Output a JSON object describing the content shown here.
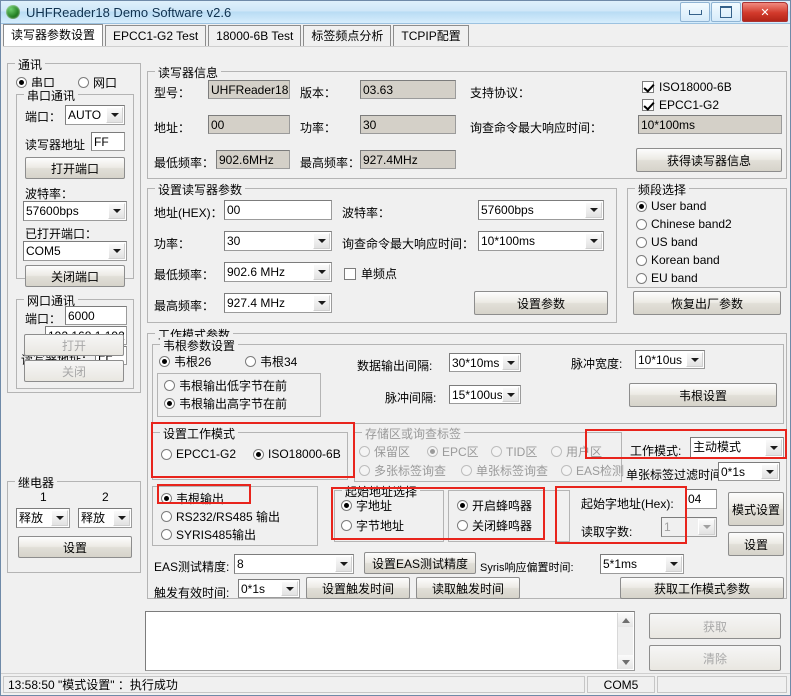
{
  "window": {
    "title": "UHFReader18 Demo Software v2.6",
    "icon": "globe-icon",
    "minimize_label": "–",
    "maximize_label": "□",
    "close_label": "✕"
  },
  "tabs": [
    {
      "label": "读写器参数设置",
      "active": true
    },
    {
      "label": "EPCC1-G2 Test",
      "active": false
    },
    {
      "label": "18000-6B Test",
      "active": false
    },
    {
      "label": "标签频点分析",
      "active": false
    },
    {
      "label": "TCPIP配置",
      "active": false
    }
  ],
  "comm": {
    "legend": "通讯",
    "mode_serial": "串口",
    "mode_net": "网口",
    "serial": {
      "legend": "串口通讯",
      "port_label": "端口：",
      "port_value": "AUTO",
      "addr_label": "读写器地址",
      "addr_value": "FF",
      "open_button": "打开端口",
      "baud_label": "波特率：",
      "baud_value": "57600bps",
      "opened_label": "已打开端口：",
      "opened_value": "COM5",
      "close_button": "关闭端口"
    },
    "net": {
      "legend": "网口通讯",
      "port_label": "端口：",
      "port_value": "6000",
      "ip_label": "IP:",
      "ip_value": "192.168.1.192",
      "addr_label": "读写器地址：",
      "addr_value": "FF",
      "open_button": "打开",
      "close_button": "关闭"
    }
  },
  "relay": {
    "legend": "继电器",
    "col1": "1",
    "col2": "2",
    "relay1_value": "释放",
    "relay2_value": "释放",
    "set_button": "设置"
  },
  "reader_info": {
    "legend": "读写器信息",
    "model_label": "型号：",
    "model_value": "UHFReader18",
    "version_label": "版本：",
    "version_value": "03.63",
    "protocol_label": "支持协议：",
    "proto_iso": "ISO18000-6B",
    "proto_epc": "EPCC1-G2",
    "addr_label": "地址：",
    "addr_value": "00",
    "power_label": "功率：",
    "power_value": "30",
    "maxresp_label": "询查命令最大响应时间：",
    "maxresp_value": "10*100ms",
    "minfreq_label": "最低频率：",
    "minfreq_value": "902.6MHz",
    "maxfreq_label": "最高频率：",
    "maxfreq_value": "927.4MHz",
    "get_button": "获得读写器信息"
  },
  "set_params": {
    "legend": "设置读写器参数",
    "addr_label": "地址(HEX)：",
    "addr_value": "00",
    "baud_label": "波特率：",
    "baud_value": "57600bps",
    "power_label": "功率：",
    "power_value": "30",
    "maxresp_label": "询查命令最大响应时间：",
    "maxresp_value": "10*100ms",
    "minfreq_label": "最低频率：",
    "minfreq_value": "902.6 MHz",
    "single_freq_label": "单频点",
    "maxfreq_label": "最高频率：",
    "maxfreq_value": "927.4 MHz",
    "set_button": "设置参数"
  },
  "band": {
    "legend": "频段选择",
    "options": [
      {
        "label": "User band",
        "selected": true
      },
      {
        "label": "Chinese band2",
        "selected": false
      },
      {
        "label": "US band",
        "selected": false
      },
      {
        "label": "Korean band",
        "selected": false
      },
      {
        "label": "EU band",
        "selected": false
      }
    ],
    "restore_button": "恢复出厂参数"
  },
  "work_mode": {
    "legend": "工作模式参数",
    "wiegand": {
      "legend": "韦根参数设置",
      "w26": "韦根26",
      "w34": "韦根34",
      "low_first": "韦根输出低字节在前",
      "high_first": "韦根输出高字节在前",
      "data_interval_label": "数据输出间隔:",
      "data_interval_value": "30*10ms",
      "pulse_width_label": "脉冲宽度:",
      "pulse_width_value": "10*10us",
      "pulse_interval_label": "脉冲间隔:",
      "pulse_interval_value": "15*100us",
      "set_button": "韦根设置"
    },
    "set_mode": {
      "legend": "设置工作模式",
      "epc": "EPCC1-G2",
      "iso": "ISO18000-6B"
    },
    "storage": {
      "legend": "存储区或询查标签",
      "r1": "保留区",
      "r2": "EPC区",
      "r3": "TID区",
      "r4": "用户区",
      "r5": "多张标签询查",
      "r6": "单张标签询查",
      "r7": "EAS检测"
    },
    "mode_label": "工作模式:",
    "mode_value": "主动模式",
    "filter_label": "单张标签过滤时间:",
    "filter_value": "0*1s",
    "output": {
      "wiegand": "韦根输出",
      "rs232": "RS232/RS485 输出",
      "syris": "SYRIS485输出"
    },
    "addr_sel": {
      "legend": "起始地址选择",
      "word": "字地址",
      "byte": "字节地址"
    },
    "buzzer": {
      "on": "开启蜂鸣器",
      "off": "关闭蜂鸣器"
    },
    "start_addr_label": "起始字地址(Hex):",
    "start_addr_value": "04",
    "word_count_label": "读取字数:",
    "word_count_value": "1",
    "mode_set_button": "模式设置",
    "set_button": "设置",
    "eas_label": "EAS测试精度:",
    "eas_value": "8",
    "eas_set_button": "设置EAS测试精度",
    "syris_label": "Syris响应偏置时间:",
    "syris_value": "5*1ms",
    "trigger_label": "触发有效时间:",
    "trigger_value": "0*1s",
    "trigger_set_button": "设置触发时间",
    "trigger_read_button": "读取触发时间",
    "get_params_button": "获取工作模式参数"
  },
  "log": {
    "text": "",
    "get_button": "获取",
    "clear_button": "清除"
  },
  "status": {
    "message": "13:58:50  \"模式设置\"  ：执行成功",
    "port": "COM5",
    "extra": ""
  },
  "colors": {
    "highlight": "#e8241c",
    "titlebar_text": "#10324f",
    "close_button": "#d23a2b"
  }
}
